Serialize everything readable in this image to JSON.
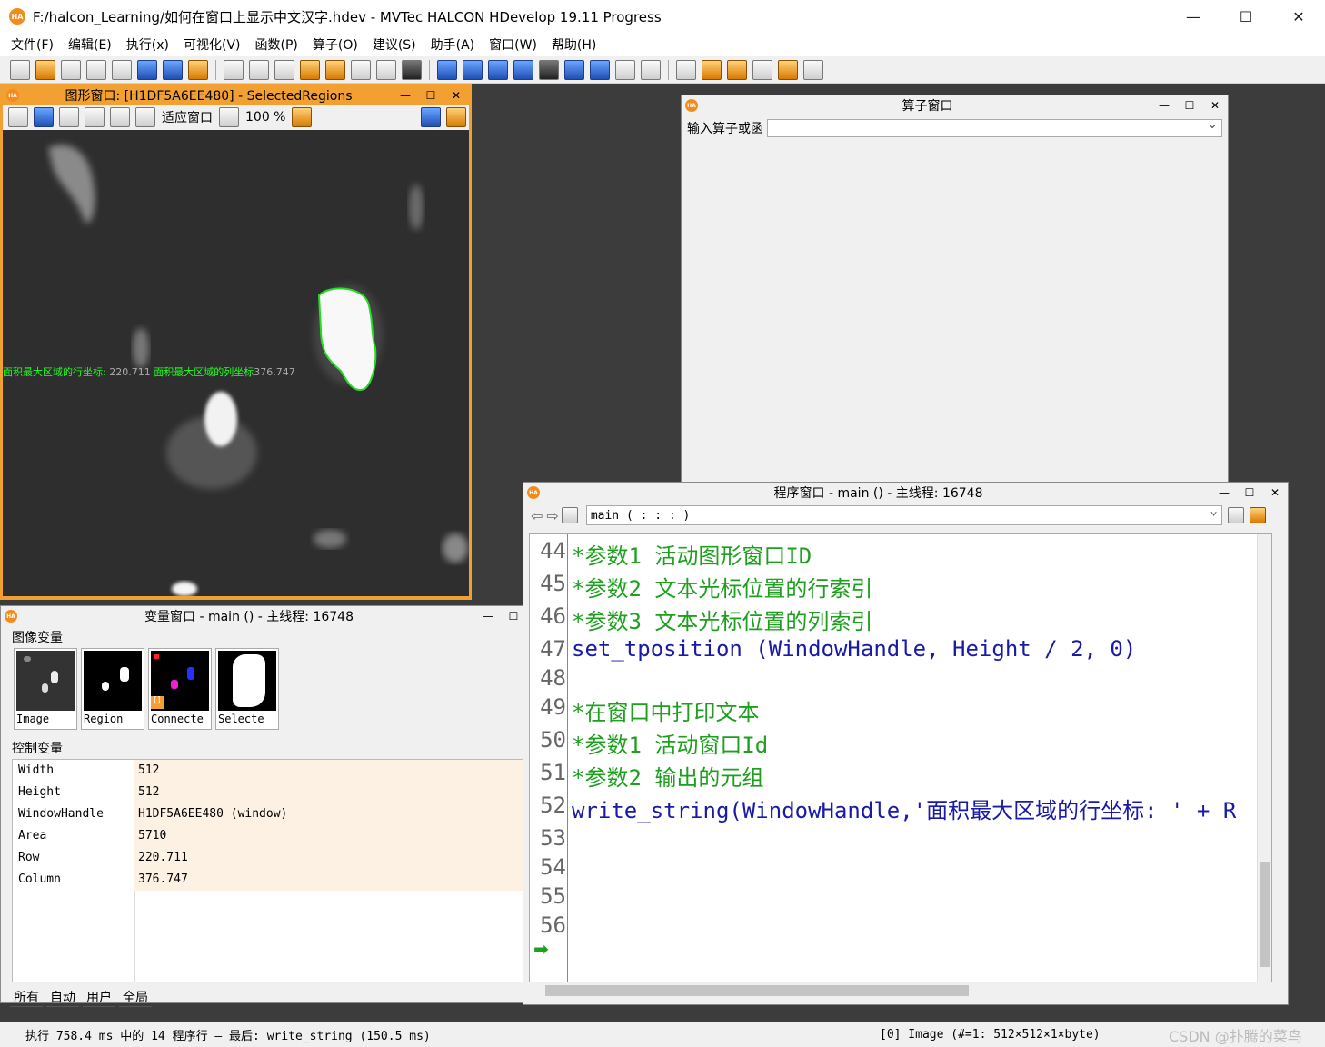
{
  "app": {
    "title": "F:/halcon_Learning/如何在窗口上显示中文汉字.hdev - MVTec HALCON HDevelop 19.11 Progress",
    "logo": "HA"
  },
  "menu": [
    "文件(F)",
    "编辑(E)",
    "执行(x)",
    "可视化(V)",
    "函数(P)",
    "算子(O)",
    "建议(S)",
    "助手(A)",
    "窗口(W)",
    "帮助(H)"
  ],
  "graphics_window": {
    "title": "图形窗口: [H1DF5A6EE480] - SelectedRegions",
    "fit_label": "适应窗口",
    "zoom_label": "100 %",
    "text_row_label": "面积最大区域的行坐标:",
    "text_row_value": "220.711",
    "text_col_label": "面积最大区域的列坐标",
    "text_col_value": "376.747"
  },
  "operator_window": {
    "title": "算子窗口",
    "input_label": "输入算子或函"
  },
  "variable_window": {
    "title": "变量窗口 - main () - 主线程: 16748",
    "iconic_group": "图像变量",
    "control_group": "控制变量",
    "thumbnails": [
      "Image",
      "Region",
      "Connecte",
      "Selecte"
    ],
    "controls": [
      {
        "name": "Width",
        "value": "512"
      },
      {
        "name": "Height",
        "value": "512"
      },
      {
        "name": "WindowHandle",
        "value": "H1DF5A6EE480 (window)"
      },
      {
        "name": "Area",
        "value": "5710"
      },
      {
        "name": "Row",
        "value": "220.711"
      },
      {
        "name": "Column",
        "value": "376.747"
      }
    ],
    "tabs": [
      "所有",
      "自动",
      "用户",
      "全局"
    ]
  },
  "program_window": {
    "title": "程序窗口 - main () - 主线程: 16748",
    "procedure": "main ( : : : )",
    "lines": [
      {
        "n": "44",
        "text": "*参数1 活动图形窗口ID",
        "kind": "comment"
      },
      {
        "n": "45",
        "text": "*参数2 文本光标位置的行索引",
        "kind": "comment"
      },
      {
        "n": "46",
        "text": "*参数3 文本光标位置的列索引",
        "kind": "comment"
      },
      {
        "n": "47",
        "text": "set_tposition (WindowHandle, Height / 2, 0)",
        "kind": "op"
      },
      {
        "n": "48",
        "text": "",
        "kind": "op"
      },
      {
        "n": "49",
        "text": "*在窗口中打印文本",
        "kind": "comment"
      },
      {
        "n": "50",
        "text": "*参数1 活动窗口Id",
        "kind": "comment"
      },
      {
        "n": "51",
        "text": "*参数2 输出的元组",
        "kind": "comment"
      },
      {
        "n": "52",
        "text": "write_string(WindowHandle,'面积最大区域的行坐标: ' + R",
        "kind": "op"
      },
      {
        "n": "53",
        "text": "",
        "kind": "op"
      },
      {
        "n": "54",
        "text": "",
        "kind": "op"
      },
      {
        "n": "55",
        "text": "",
        "kind": "op"
      },
      {
        "n": "56",
        "text": "",
        "kind": "op"
      }
    ]
  },
  "status": {
    "left": "执行 758.4 ms 中的 14 程序行 — 最后: write_string (150.5 ms)",
    "right": "[0] Image (#=1: 512×512×1×byte)",
    "watermark": "CSDN @扑腾的菜鸟"
  },
  "colors": {
    "accent": "#f2a032",
    "comment": "#1ea01e",
    "operator": "#1a1aa8",
    "window_text": "#22ff22"
  }
}
